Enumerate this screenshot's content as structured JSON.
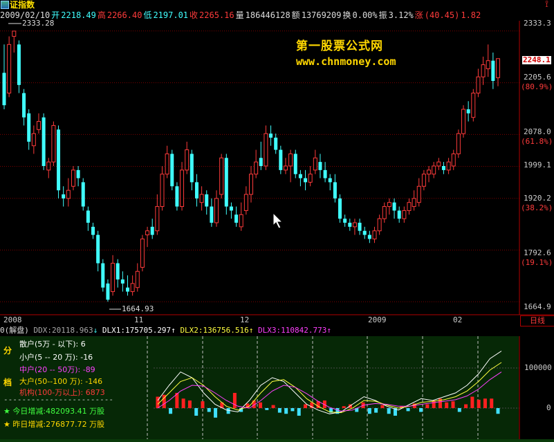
{
  "window": {
    "title": "证指数"
  },
  "quote": {
    "date": "2009/02/10",
    "open_label": "开",
    "open": "2218.49",
    "high_label": "高",
    "high": "2266.40",
    "low_label": "低",
    "low": "2197.01",
    "close_label": "收",
    "close": "2265.16",
    "volume_label": "量",
    "volume": "186446128",
    "amount_label": "额",
    "amount": "13769209",
    "turnover_label": "换",
    "turnover": "0.00%",
    "amplitude_label": "振",
    "amplitude": "3.12%",
    "change_label": "涨",
    "change": "(40.45)",
    "change_pct": "1.82"
  },
  "watermark": {
    "line1": "第一股票公式网",
    "line2": "www.chnmoney.com"
  },
  "price_axis": {
    "labels": [
      "2333.3",
      "2205.6",
      "(80.9%)",
      "2078.0",
      "(61.8%)",
      "1999.1",
      "1920.2",
      "(38.2%)",
      "1792.6",
      "(19.1%)",
      "1664.9"
    ],
    "current_price": "2248.1"
  },
  "annotations": {
    "high": "2333.28",
    "low": "1664.93"
  },
  "time_axis": {
    "labels": [
      "2008",
      "11",
      "12",
      "2009",
      "02"
    ],
    "unit_button": "日线"
  },
  "indicator_header": {
    "name": "0(解盘)",
    "ddx": "DDX:20118.963",
    "dlx1": "DLX1:175705.297",
    "dlx2": "DLX2:136756.516",
    "dlx3": "DLX3:110842.773"
  },
  "sub_axis": {
    "labels": [
      "100000",
      "0"
    ]
  },
  "tabs": [
    "分",
    "档"
  ],
  "holders": {
    "retail_label": "散户(5万 - 以下):",
    "retail": "6",
    "small_label": "小户(5 -- 20 万):",
    "small": "-16",
    "medium_label": "中户(20 -- 50万):",
    "medium": "-89",
    "large_label": "大户(50--100 万):",
    "large": "-146",
    "inst_label": "机构(100-万以上):",
    "inst": "6873",
    "separator": "------------------------",
    "today_label": "今日增减:",
    "today": "482093.41",
    "today_unit": "万股",
    "yesterday_label": "昨日增减:",
    "yesterday": "276877.72",
    "yesterday_unit": "万股"
  },
  "colors": {
    "up": "#ff3b3b",
    "down": "#40ffff",
    "grid": "#800000",
    "accent": "#ffe000",
    "dlx1": "#ffffff",
    "dlx2": "#ffff40",
    "dlx3": "#ff40ff",
    "panel_bg": "#062806"
  },
  "chart_data": {
    "type": "candlestick",
    "ylim": [
      1650,
      2350
    ],
    "candles": [
      [
        2230,
        2150,
        2300,
        2140
      ],
      [
        2180,
        2300,
        2320,
        2170
      ],
      [
        2320,
        2333,
        2333,
        2280
      ],
      [
        2300,
        2200,
        2310,
        2180
      ],
      [
        2180,
        2120,
        2190,
        2100
      ],
      [
        2130,
        2060,
        2140,
        2040
      ],
      [
        2050,
        2080,
        2100,
        2030
      ],
      [
        2090,
        2110,
        2130,
        2080
      ],
      [
        2120,
        2000,
        2130,
        1990
      ],
      [
        1990,
        2010,
        2020,
        1970
      ],
      [
        2010,
        2100,
        2110,
        2000
      ],
      [
        2090,
        1940,
        2100,
        1920
      ],
      [
        1930,
        1920,
        1950,
        1900
      ],
      [
        1920,
        1940,
        1970,
        1900
      ],
      [
        1950,
        1990,
        2000,
        1940
      ],
      [
        1990,
        1970,
        2000,
        1950
      ],
      [
        1960,
        1900,
        1970,
        1890
      ],
      [
        1890,
        1860,
        1900,
        1840
      ],
      [
        1850,
        1830,
        1860,
        1820
      ],
      [
        1830,
        1760,
        1840,
        1740
      ],
      [
        1760,
        1700,
        1770,
        1690
      ],
      [
        1710,
        1670,
        1720,
        1665
      ],
      [
        1690,
        1760,
        1780,
        1680
      ],
      [
        1760,
        1720,
        1770,
        1700
      ],
      [
        1720,
        1710,
        1740,
        1690
      ],
      [
        1700,
        1690,
        1730,
        1680
      ],
      [
        1690,
        1710,
        1730,
        1680
      ],
      [
        1700,
        1740,
        1760,
        1690
      ],
      [
        1750,
        1820,
        1830,
        1740
      ],
      [
        1830,
        1840,
        1850,
        1800
      ],
      [
        1850,
        1830,
        1870,
        1820
      ],
      [
        1840,
        1900,
        1930,
        1830
      ],
      [
        1900,
        1980,
        2000,
        1890
      ],
      [
        1980,
        2030,
        2050,
        1970
      ],
      [
        2030,
        1950,
        2040,
        1940
      ],
      [
        1950,
        1900,
        1960,
        1890
      ],
      [
        1900,
        1990,
        2010,
        1890
      ],
      [
        1990,
        2040,
        2060,
        1980
      ],
      [
        2030,
        1960,
        2040,
        1940
      ],
      [
        1960,
        1920,
        1980,
        1900
      ],
      [
        1910,
        1930,
        1950,
        1890
      ],
      [
        1930,
        1900,
        1940,
        1880
      ],
      [
        1900,
        1860,
        1920,
        1850
      ],
      [
        1860,
        1920,
        1940,
        1850
      ],
      [
        1930,
        2020,
        2030,
        1920
      ],
      [
        2020,
        1900,
        2030,
        1880
      ],
      [
        1900,
        1890,
        1910,
        1870
      ],
      [
        1880,
        1860,
        1900,
        1850
      ],
      [
        1850,
        1880,
        1910,
        1840
      ],
      [
        1890,
        1930,
        1950,
        1880
      ],
      [
        1930,
        1980,
        2000,
        1910
      ],
      [
        1980,
        2010,
        2040,
        1970
      ],
      [
        2020,
        2000,
        2060,
        1990
      ],
      [
        2000,
        2080,
        2100,
        1990
      ],
      [
        2080,
        2070,
        2100,
        2050
      ],
      [
        2070,
        2040,
        2080,
        2030
      ],
      [
        2040,
        1990,
        2050,
        1980
      ],
      [
        1990,
        2000,
        2020,
        1980
      ],
      [
        2000,
        2030,
        2040,
        1960
      ],
      [
        2030,
        1980,
        2040,
        1970
      ],
      [
        1980,
        1970,
        1990,
        1950
      ],
      [
        1970,
        1960,
        1990,
        1940
      ],
      [
        1960,
        1980,
        2000,
        1950
      ],
      [
        1990,
        2020,
        2040,
        1980
      ],
      [
        2010,
        1990,
        2030,
        1970
      ],
      [
        1990,
        1970,
        2010,
        1960
      ],
      [
        1970,
        1960,
        1980,
        1940
      ],
      [
        1960,
        1920,
        1980,
        1910
      ],
      [
        1920,
        1870,
        1930,
        1860
      ],
      [
        1870,
        1860,
        1880,
        1850
      ],
      [
        1860,
        1850,
        1870,
        1840
      ],
      [
        1850,
        1860,
        1870,
        1830
      ],
      [
        1860,
        1840,
        1870,
        1830
      ],
      [
        1840,
        1830,
        1850,
        1820
      ],
      [
        1830,
        1820,
        1840,
        1810
      ],
      [
        1820,
        1840,
        1850,
        1810
      ],
      [
        1840,
        1870,
        1880,
        1830
      ],
      [
        1870,
        1900,
        1910,
        1860
      ],
      [
        1900,
        1910,
        1920,
        1880
      ],
      [
        1910,
        1890,
        1920,
        1870
      ],
      [
        1890,
        1870,
        1900,
        1860
      ],
      [
        1870,
        1890,
        1900,
        1860
      ],
      [
        1890,
        1910,
        1920,
        1880
      ],
      [
        1900,
        1920,
        1940,
        1890
      ],
      [
        1910,
        1950,
        1970,
        1900
      ],
      [
        1950,
        1980,
        1990,
        1940
      ],
      [
        1980,
        1990,
        2000,
        1960
      ],
      [
        1980,
        2000,
        2010,
        1970
      ],
      [
        2000,
        2010,
        2020,
        1990
      ],
      [
        2000,
        1990,
        2010,
        1980
      ],
      [
        1990,
        2010,
        2020,
        1980
      ],
      [
        2000,
        2030,
        2040,
        1990
      ],
      [
        2030,
        2080,
        2090,
        2020
      ],
      [
        2080,
        2140,
        2150,
        2070
      ],
      [
        2140,
        2130,
        2160,
        2110
      ],
      [
        2120,
        2180,
        2190,
        2110
      ],
      [
        2180,
        2220,
        2240,
        2170
      ],
      [
        2220,
        2250,
        2270,
        2200
      ],
      [
        2240,
        2260,
        2300,
        2220
      ],
      [
        2260,
        2210,
        2280,
        2190
      ],
      [
        2218,
        2265,
        2266,
        2197
      ]
    ],
    "bars": [
      30,
      35,
      -15,
      40,
      25,
      20,
      -20,
      18,
      -10,
      -25,
      15,
      -15,
      40,
      -10,
      12,
      20,
      15,
      -5,
      8,
      -12,
      -15,
      -8,
      -20,
      10,
      15,
      18,
      20,
      -12,
      -15,
      5,
      10,
      -10,
      15,
      -15,
      -12,
      8,
      -15,
      -20,
      5,
      -8,
      12,
      -10,
      10,
      20,
      25,
      15,
      18,
      -10,
      10,
      30,
      22,
      25,
      25,
      -15
    ],
    "series": [
      {
        "name": "DLX1",
        "values": [
          20,
          60,
          95,
          80,
          40,
          10,
          -5,
          -10,
          20,
          60,
          80,
          70,
          40,
          10,
          -5,
          -15,
          -10,
          10,
          30,
          20,
          5,
          -5,
          10,
          25,
          20,
          30,
          40,
          60,
          90,
          130,
          150
        ]
      },
      {
        "name": "DLX2",
        "values": [
          10,
          40,
          70,
          80,
          60,
          30,
          5,
          -5,
          5,
          40,
          70,
          75,
          55,
          25,
          5,
          -10,
          -12,
          0,
          20,
          18,
          8,
          0,
          5,
          15,
          18,
          22,
          30,
          45,
          70,
          100,
          120
        ]
      },
      {
        "name": "DLX3",
        "values": [
          0,
          20,
          45,
          60,
          58,
          40,
          20,
          5,
          0,
          20,
          45,
          60,
          55,
          38,
          18,
          2,
          -8,
          -5,
          8,
          12,
          10,
          5,
          5,
          10,
          14,
          18,
          22,
          32,
          50,
          75,
          95
        ]
      }
    ]
  }
}
